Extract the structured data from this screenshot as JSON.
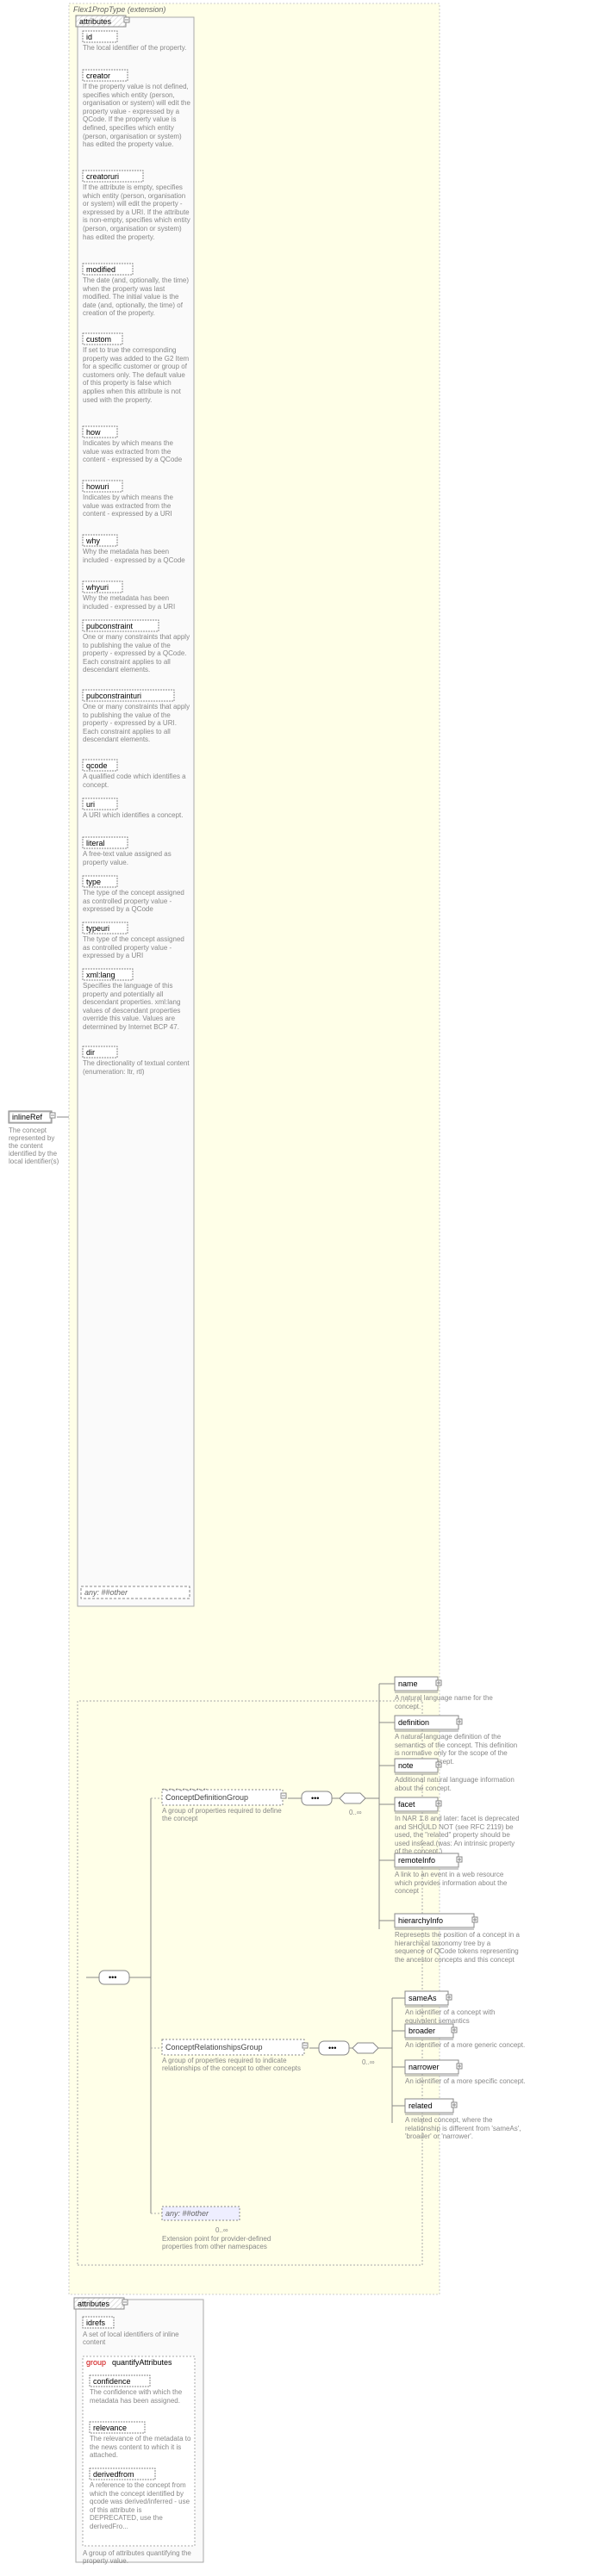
{
  "root": {
    "name": "inlineRef",
    "description": "The concept represented by the content identified by the local identifier(s)"
  },
  "header": {
    "title": "Flex1PropType (extension)"
  },
  "attributes_label": "attributes",
  "attrs1": [
    {
      "name": "id",
      "desc": "The local identifier of the property."
    },
    {
      "name": "creator",
      "desc": "If the property value is not defined, specifies which entity (person, organisation or system) will edit the property value - expressed by a QCode. If the property value is defined, specifies which entity (person, organisation or system) has edited the property value."
    },
    {
      "name": "creatoruri",
      "desc": "If the attribute is empty, specifies which entity (person, organisation or system) will edit the property - expressed by a URI. If the attribute is non-empty, specifies which entity (person, organisation or system) has edited the property."
    },
    {
      "name": "modified",
      "desc": "The date (and, optionally, the time) when the property was last modified. The initial value is the date (and, optionally, the time) of creation of the property."
    },
    {
      "name": "custom",
      "desc": "If set to true the corresponding property was added to the G2 Item for a specific customer or group of customers only. The default value of this property is false which applies when this attribute is not used with the property."
    },
    {
      "name": "how",
      "desc": "Indicates by which means the value was extracted from the content - expressed by a QCode"
    },
    {
      "name": "howuri",
      "desc": "Indicates by which means the value was extracted from the content - expressed by a URI"
    },
    {
      "name": "why",
      "desc": "Why the metadata has been included - expressed by a QCode"
    },
    {
      "name": "whyuri",
      "desc": "Why the metadata has been included - expressed by a URI"
    },
    {
      "name": "pubconstraint",
      "desc": "One or many constraints that apply to publishing the value of the property - expressed by a QCode. Each constraint applies to all descendant elements."
    },
    {
      "name": "pubconstrainturi",
      "desc": "One or many constraints that apply to publishing the value of the property - expressed by a URI. Each constraint applies to all descendant elements."
    },
    {
      "name": "qcode",
      "desc": "A qualified code which identifies a concept."
    },
    {
      "name": "uri",
      "desc": "A URI which identifies a concept."
    },
    {
      "name": "literal",
      "desc": "A free-text value assigned as property value."
    },
    {
      "name": "type",
      "desc": "The type of the concept assigned as controlled property value - expressed by a QCode"
    },
    {
      "name": "typeuri",
      "desc": "The type of the concept assigned as controlled property value - expressed by a URI"
    },
    {
      "name": "xml:lang",
      "desc": "Specifies the language of this property and potentially all descendant properties. xml:lang values of descendant properties override this value. Values are determined by Internet BCP 47."
    },
    {
      "name": "dir",
      "desc": "The directionality of textual content (enumeration: ltr, rtl)"
    }
  ],
  "any_other": "any: ##other",
  "seq": "•••",
  "cdg": {
    "name": "ConceptDefinitionGroup",
    "desc": "A group of properties required to define the concept",
    "card": "0..∞",
    "items": [
      {
        "name": "name",
        "desc": "A natural language name for the concept."
      },
      {
        "name": "definition",
        "desc": "A natural language definition of the semantics of the concept. This definition is normative only for the scope of the use of this concept."
      },
      {
        "name": "note",
        "desc": "Additional natural language information about the concept."
      },
      {
        "name": "facet",
        "desc": "In NAR 1.8 and later: facet is deprecated and SHOULD NOT (see RFC 2119) be used, the \"related\" property should be used instead.(was: An intrinsic property of the concept.)"
      },
      {
        "name": "remoteInfo",
        "desc": "A link to an event in a web resource which provides information about the concept"
      },
      {
        "name": "hierarchyInfo",
        "desc": "Represents the position of a concept in a hierarchical taxonomy tree by a sequence of QCode tokens representing the ancestor concepts and this concept"
      }
    ]
  },
  "crg": {
    "name": "ConceptRelationshipsGroup",
    "desc": "A group of properties required to indicate relationships of the concept to other concepts",
    "card": "0..∞",
    "items": [
      {
        "name": "sameAs",
        "desc": "An identifier of a concept with equivalent semantics"
      },
      {
        "name": "broader",
        "desc": "An identifier of a more generic concept."
      },
      {
        "name": "narrower",
        "desc": "An identifier of a more specific concept."
      },
      {
        "name": "related",
        "desc": "A related concept, where the relationship is different from 'sameAs', 'broader' or 'narrower'."
      }
    ]
  },
  "ext": {
    "any": "any: ##other",
    "card": "0..∞",
    "desc": "Extension point for provider-defined properties from other namespaces"
  },
  "attrs2_label": "attributes",
  "idrefs": {
    "name": "idrefs",
    "desc": "A set of local identifiers of inline content"
  },
  "qattr": {
    "name": "group",
    "subtitle": "quantifyAttributes"
  },
  "qitems": [
    {
      "name": "confidence",
      "desc": "The confidence with which the metadata has been assigned."
    },
    {
      "name": "relevance",
      "desc": "The relevance of the metadata to the news content to which it is attached."
    },
    {
      "name": "derivedfrom",
      "desc": "A reference to the concept from which the concept identified by qcode was derived/inferred - use of this attribute is DEPRECATED, use the derivedFro..."
    }
  ],
  "qdesc": "A group of attributes quantifying the property value."
}
